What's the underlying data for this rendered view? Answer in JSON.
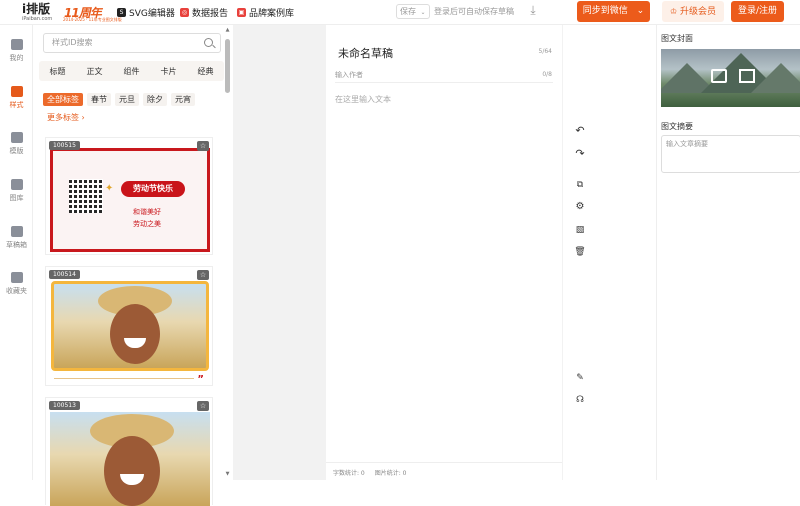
{
  "brand": {
    "logo": "i排版",
    "logo_sub": "iPaiban.com",
    "anniversary": "11周年",
    "anniversary_sub": "2014-2025 · 11年专业图文排版"
  },
  "nav": [
    {
      "label": "SVG编辑器",
      "icon": "svg-icon",
      "color": "#222222"
    },
    {
      "label": "数据报告",
      "icon": "report-icon",
      "color": "#e8413c"
    },
    {
      "label": "品牌案例库",
      "icon": "case-icon",
      "color": "#e8413c"
    }
  ],
  "toolbar": {
    "save_label": "保存",
    "save_hint": "登录后可自动保存草稿",
    "sync_label": "同步到微信",
    "vip_label": "升级会员",
    "login_label": "登录/注册"
  },
  "rail": [
    {
      "label": "我的",
      "active": false
    },
    {
      "label": "样式",
      "active": true
    },
    {
      "label": "模版",
      "active": false
    },
    {
      "label": "图库",
      "active": false
    },
    {
      "label": "草稿箱",
      "active": false
    },
    {
      "label": "收藏夹",
      "active": false
    }
  ],
  "styles_panel": {
    "search_placeholder": "样式ID搜索",
    "categories": [
      "标题",
      "正文",
      "组件",
      "卡片",
      "经典"
    ],
    "tags": [
      "全部标签",
      "春节",
      "元旦",
      "除夕",
      "元宵"
    ],
    "more_tags": "更多标签 ›",
    "templates": [
      {
        "id": "100515",
        "title": "劳动节快乐",
        "line1": "和谐美好",
        "line2": "劳动之美"
      },
      {
        "id": "100514",
        "quote_mark": "”"
      },
      {
        "id": "100513"
      }
    ]
  },
  "editor": {
    "title": "未命名草稿",
    "title_count": "5/64",
    "author_placeholder": "输入作者",
    "author_count": "0/8",
    "body_placeholder": "在这里输入文本",
    "word_count": "字数统计: 0",
    "image_count": "图片统计: 0"
  },
  "right_panel": {
    "cover_label": "图文封面",
    "summary_label": "图文摘要",
    "summary_placeholder": "输入文章摘要"
  },
  "colors": {
    "accent": "#ec5b1b",
    "festival_red": "#c9141a",
    "frame_gold": "#f4b63e"
  }
}
